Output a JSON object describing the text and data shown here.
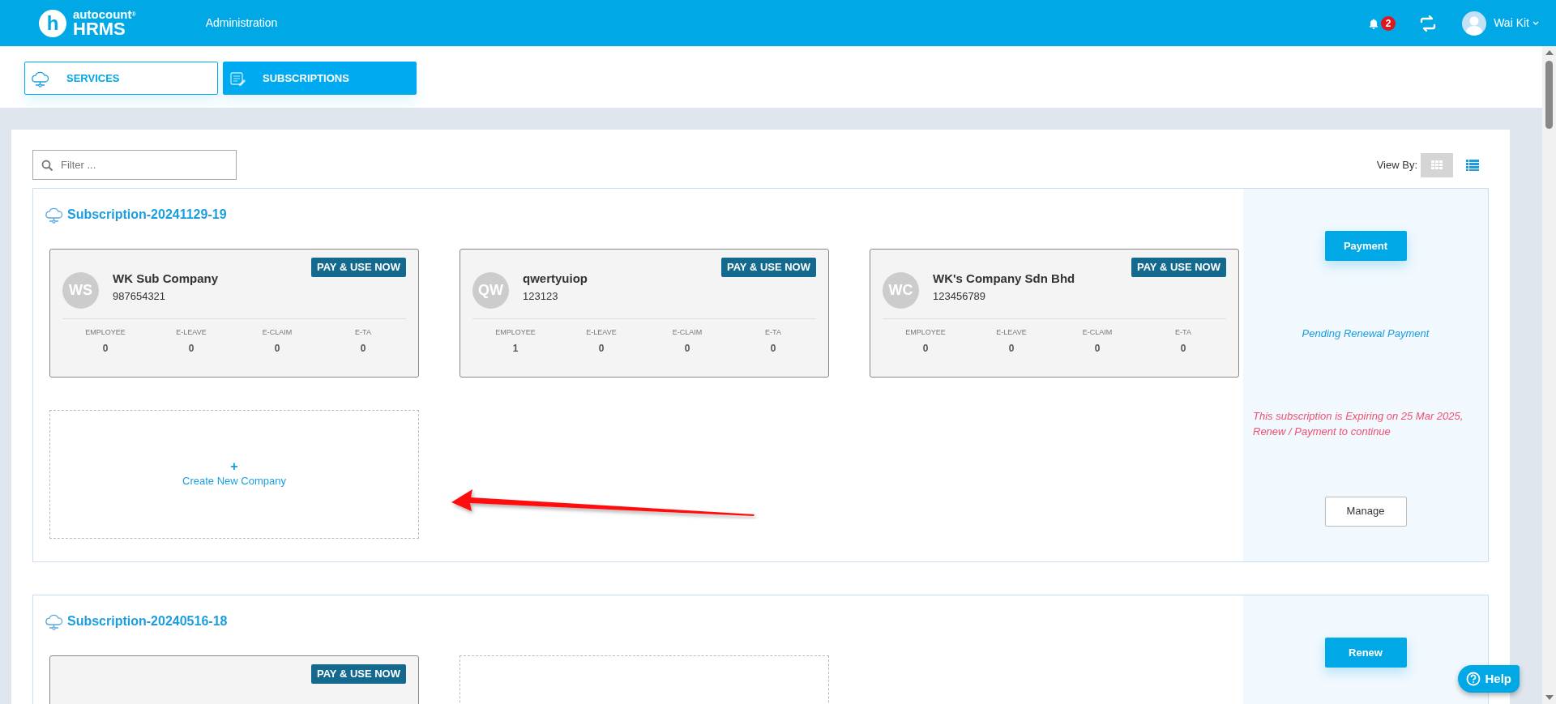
{
  "header": {
    "logo": {
      "mark": "h",
      "top": "autocount",
      "reg": "®",
      "bottom": "HRMS"
    },
    "menu": "Administration",
    "notifications": "2",
    "user": "Wai Kit"
  },
  "tabs": [
    {
      "label": "SERVICES",
      "selected": false
    },
    {
      "label": "SUBSCRIPTIONS",
      "selected": true
    }
  ],
  "filter": {
    "placeholder": "Filter ..."
  },
  "view_by": {
    "label": "View By:",
    "options": [
      {
        "selected": true
      },
      {
        "selected": false
      }
    ]
  },
  "subscriptions": [
    {
      "title": "Subscription-20241129-19",
      "tiles": [
        {
          "kind": "company",
          "badge": "PAY & USE NOW",
          "initials": "WS",
          "name": "WK Sub Company",
          "code": "987654321",
          "stats": [
            {
              "label": "EMPLOYEE",
              "value": "0"
            },
            {
              "label": "E-LEAVE",
              "value": "0"
            },
            {
              "label": "E-CLAIM",
              "value": "0"
            },
            {
              "label": "E-TA",
              "value": "0"
            }
          ]
        },
        {
          "kind": "company",
          "badge": "PAY & USE NOW",
          "initials": "QW",
          "name": "qwertyuiop",
          "code": "123123",
          "stats": [
            {
              "label": "EMPLOYEE",
              "value": "1"
            },
            {
              "label": "E-LEAVE",
              "value": "0"
            },
            {
              "label": "E-CLAIM",
              "value": "0"
            },
            {
              "label": "E-TA",
              "value": "0"
            }
          ]
        },
        {
          "kind": "company",
          "badge": "PAY & USE NOW",
          "initials": "WC",
          "name": "WK's Company Sdn Bhd",
          "code": "123456789",
          "stats": [
            {
              "label": "EMPLOYEE",
              "value": "0"
            },
            {
              "label": "E-LEAVE",
              "value": "0"
            },
            {
              "label": "E-CLAIM",
              "value": "0"
            },
            {
              "label": "E-TA",
              "value": "0"
            }
          ]
        },
        {
          "kind": "create",
          "icon": "+",
          "label": "Create New Company"
        }
      ],
      "side": [
        {
          "kind": "primary",
          "text": "Payment"
        },
        {
          "kind": "status",
          "text": "Pending Renewal Payment"
        },
        {
          "kind": "warning",
          "text": "This subscription is Expiring on 25 Mar 2025, Renew / Payment to continue"
        },
        {
          "kind": "secondary",
          "text": "Manage"
        }
      ]
    },
    {
      "title": "Subscription-20240516-18",
      "tiles": [
        {
          "kind": "company",
          "badge": "PAY & USE NOW"
        },
        {
          "kind": "create"
        }
      ],
      "side": [
        {
          "kind": "primary",
          "text": "Renew"
        }
      ]
    }
  ],
  "help": {
    "label": "Help"
  }
}
